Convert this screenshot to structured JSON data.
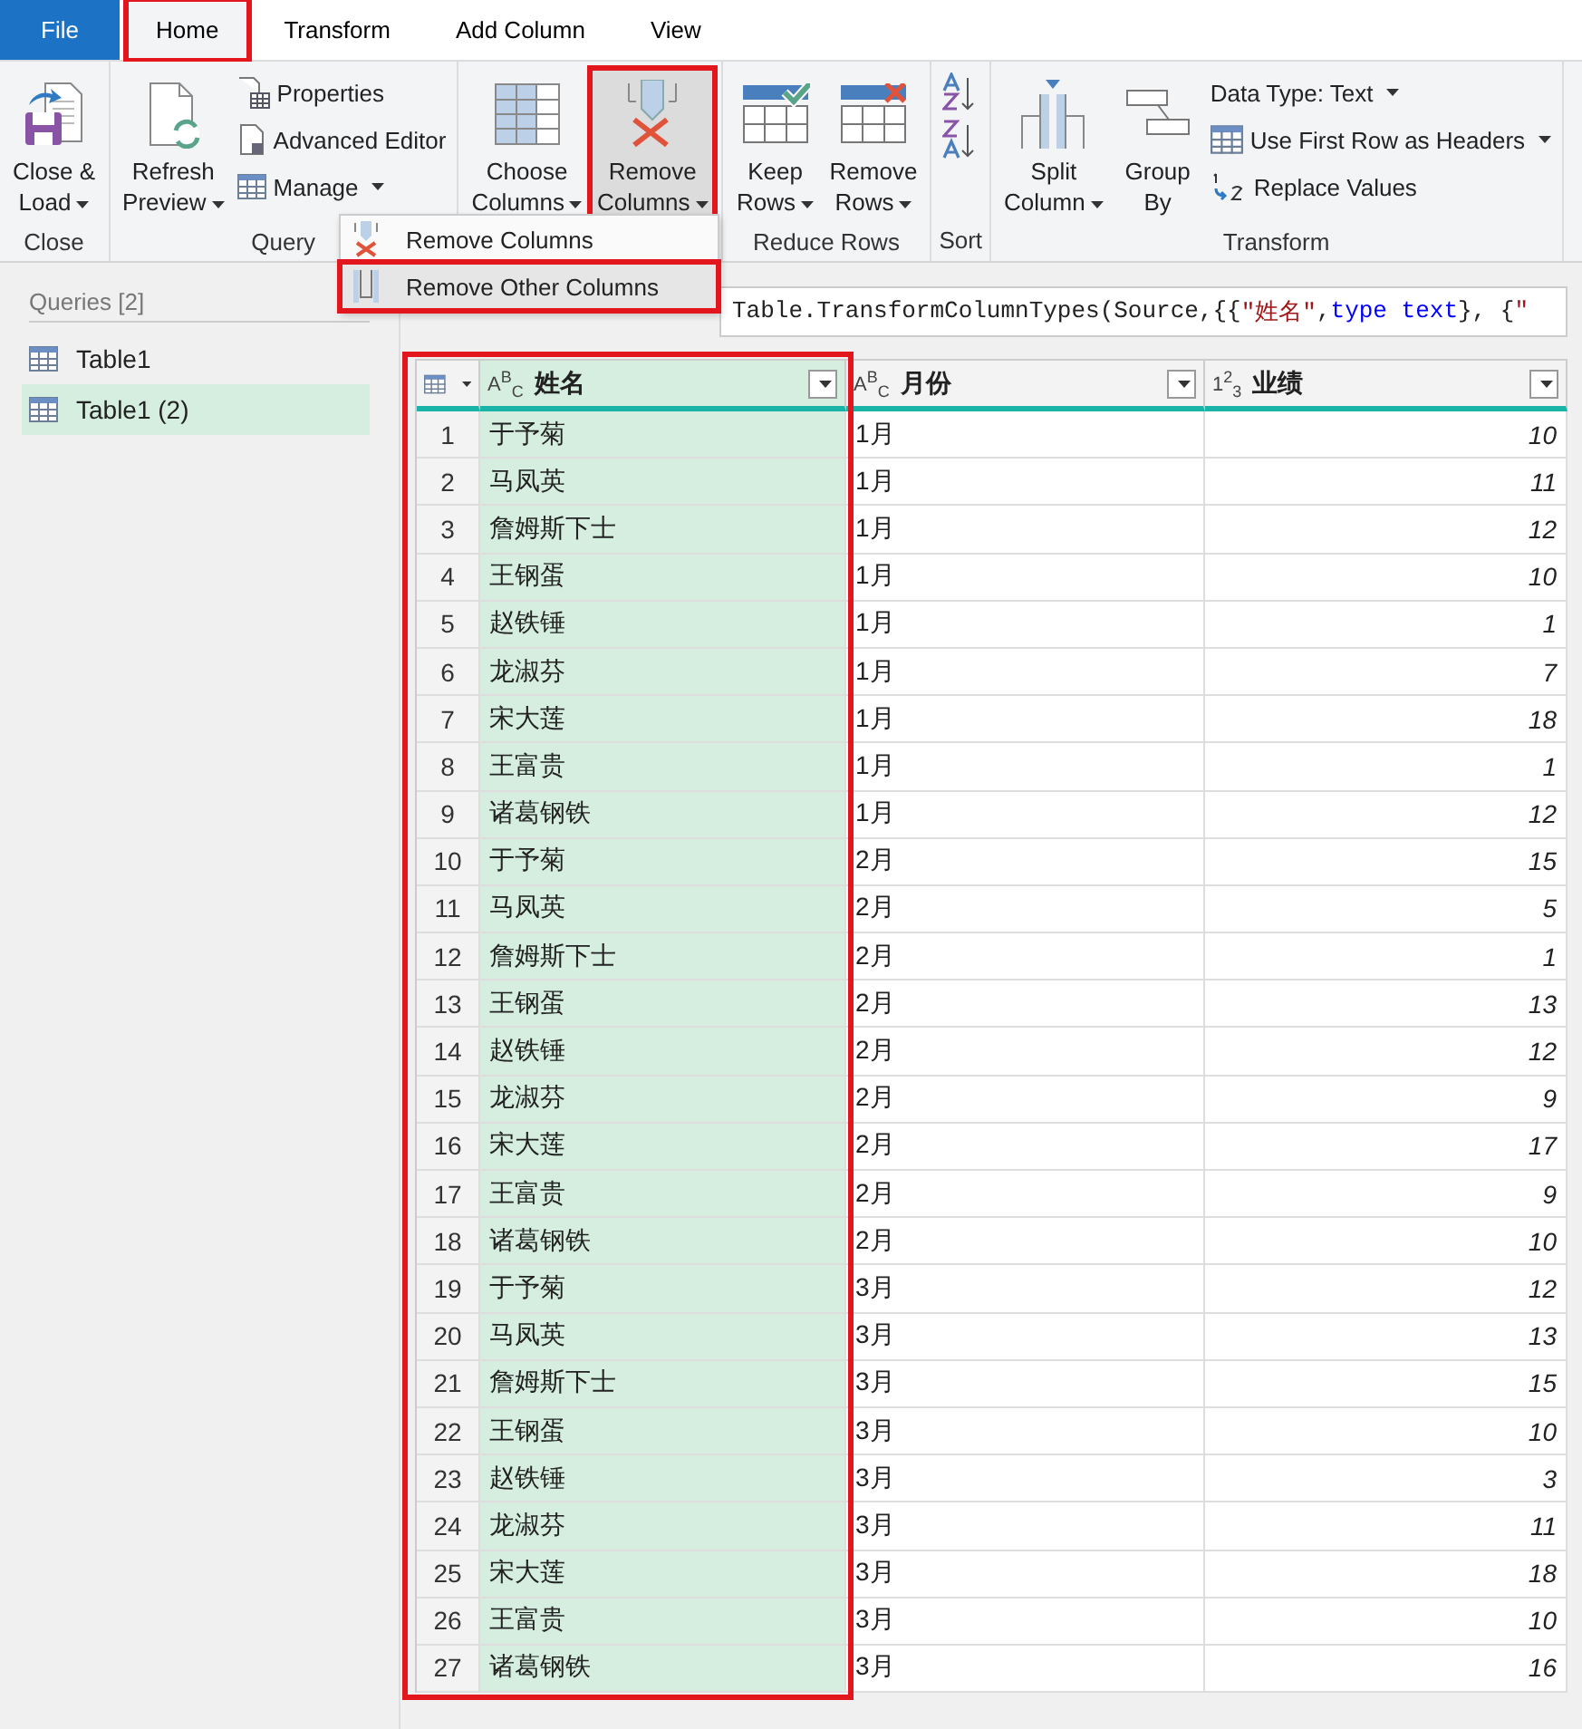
{
  "tabs": [
    {
      "label": "File",
      "kind": "file",
      "selected": false,
      "highlighted": false
    },
    {
      "label": "Home",
      "kind": "tab",
      "selected": true,
      "highlighted": true
    },
    {
      "label": "Transform",
      "kind": "tab",
      "selected": false,
      "highlighted": false
    },
    {
      "label": "Add Column",
      "kind": "tab",
      "selected": false,
      "highlighted": false
    },
    {
      "label": "View",
      "kind": "tab",
      "selected": false,
      "highlighted": false
    }
  ],
  "ribbon": {
    "groups": [
      {
        "label": "Close",
        "large": [
          {
            "lines": [
              "Close &",
              "Load"
            ],
            "dropdown": true,
            "pressed": false,
            "highlighted": false
          }
        ]
      },
      {
        "label": "Query",
        "large": [
          {
            "lines": [
              "Refresh",
              "Preview"
            ],
            "dropdown": true,
            "pressed": false,
            "highlighted": false
          }
        ],
        "small": [
          {
            "label": "Properties",
            "dropdown": false
          },
          {
            "label": "Advanced Editor",
            "dropdown": false
          },
          {
            "label": "Manage",
            "dropdown": true
          }
        ]
      },
      {
        "large": [
          {
            "lines": [
              "Choose",
              "Columns"
            ],
            "dropdown": true,
            "pressed": false,
            "highlighted": false
          },
          {
            "lines": [
              "Remove",
              "Columns"
            ],
            "dropdown": true,
            "pressed": true,
            "highlighted": true
          }
        ]
      },
      {
        "label": "Reduce Rows",
        "large": [
          {
            "lines": [
              "Keep",
              "Rows"
            ],
            "dropdown": true,
            "pressed": false,
            "highlighted": false
          },
          {
            "lines": [
              "Remove",
              "Rows"
            ],
            "dropdown": true,
            "pressed": false,
            "highlighted": false
          }
        ]
      },
      {
        "label": "Sort",
        "small": [
          {
            "dropdown": false
          },
          {
            "dropdown": false
          }
        ]
      },
      {
        "label": "Transform",
        "large": [
          {
            "lines": [
              "Split",
              "Column"
            ],
            "dropdown": true,
            "pressed": false,
            "highlighted": false
          },
          {
            "lines": [
              "Group",
              "By"
            ],
            "dropdown": false,
            "pressed": false,
            "highlighted": false
          }
        ],
        "small": [
          {
            "label": "Data Type: Text",
            "dropdown": true
          },
          {
            "label": "Use First Row as Headers",
            "dropdown": true
          },
          {
            "label": "Replace Values",
            "dropdown": false
          }
        ]
      }
    ]
  },
  "menu": {
    "items": [
      {
        "label": "Remove Columns",
        "selected": false,
        "highlighted": false
      },
      {
        "label": "Remove Other Columns",
        "selected": true,
        "highlighted": true
      }
    ]
  },
  "queries": {
    "title": "Queries [2]",
    "items": [
      {
        "label": "Table1",
        "selected": false
      },
      {
        "label": "Table1 (2)",
        "selected": true
      }
    ]
  },
  "formula": {
    "tokens": [
      {
        "kind": "plain",
        "text": "Table.TransformColumnTypes(Source,{{"
      },
      {
        "kind": "string",
        "text": "\"姓名\""
      },
      {
        "kind": "plain",
        "text": ", "
      },
      {
        "kind": "keyword",
        "text": "type text"
      },
      {
        "kind": "plain",
        "text": "}, {"
      },
      {
        "kind": "string",
        "text": "\""
      }
    ]
  },
  "table": {
    "columns": [
      {
        "type": "A$^{B}$$_{C}$",
        "name": "姓名",
        "selected": true,
        "highlighted": true
      },
      {
        "type": "A$^{B}$$_{C}$",
        "name": "月份",
        "selected": false,
        "highlighted": false
      },
      {
        "type": "1$^{2}$$_{3}$",
        "name": "业绩",
        "selected": false,
        "highlighted": false
      }
    ],
    "rows": [
      {
        "number": "1",
        "cells": [
          "于予菊",
          "1月",
          "10"
        ]
      },
      {
        "number": "2",
        "cells": [
          "马凤英",
          "1月",
          "11"
        ]
      },
      {
        "number": "3",
        "cells": [
          "詹姆斯下士",
          "1月",
          "12"
        ]
      },
      {
        "number": "4",
        "cells": [
          "王钢蛋",
          "1月",
          "10"
        ]
      },
      {
        "number": "5",
        "cells": [
          "赵铁锤",
          "1月",
          "1"
        ]
      },
      {
        "number": "6",
        "cells": [
          "龙淑芬",
          "1月",
          "7"
        ]
      },
      {
        "number": "7",
        "cells": [
          "宋大莲",
          "1月",
          "18"
        ]
      },
      {
        "number": "8",
        "cells": [
          "王富贵",
          "1月",
          "1"
        ]
      },
      {
        "number": "9",
        "cells": [
          "诸葛钢铁",
          "1月",
          "12"
        ]
      },
      {
        "number": "10",
        "cells": [
          "于予菊",
          "2月",
          "15"
        ]
      },
      {
        "number": "11",
        "cells": [
          "马凤英",
          "2月",
          "5"
        ]
      },
      {
        "number": "12",
        "cells": [
          "詹姆斯下士",
          "2月",
          "1"
        ]
      },
      {
        "number": "13",
        "cells": [
          "王钢蛋",
          "2月",
          "13"
        ]
      },
      {
        "number": "14",
        "cells": [
          "赵铁锤",
          "2月",
          "12"
        ]
      },
      {
        "number": "15",
        "cells": [
          "龙淑芬",
          "2月",
          "9"
        ]
      },
      {
        "number": "16",
        "cells": [
          "宋大莲",
          "2月",
          "17"
        ]
      },
      {
        "number": "17",
        "cells": [
          "王富贵",
          "2月",
          "9"
        ]
      },
      {
        "number": "18",
        "cells": [
          "诸葛钢铁",
          "2月",
          "10"
        ]
      },
      {
        "number": "19",
        "cells": [
          "于予菊",
          "3月",
          "12"
        ]
      },
      {
        "number": "20",
        "cells": [
          "马凤英",
          "3月",
          "13"
        ]
      },
      {
        "number": "21",
        "cells": [
          "詹姆斯下士",
          "3月",
          "15"
        ]
      },
      {
        "number": "22",
        "cells": [
          "王钢蛋",
          "3月",
          "10"
        ]
      },
      {
        "number": "23",
        "cells": [
          "赵铁锤",
          "3月",
          "3"
        ]
      },
      {
        "number": "24",
        "cells": [
          "龙淑芬",
          "3月",
          "11"
        ]
      },
      {
        "number": "25",
        "cells": [
          "宋大莲",
          "3月",
          "18"
        ]
      },
      {
        "number": "26",
        "cells": [
          "王富贵",
          "3月",
          "10"
        ]
      },
      {
        "number": "27",
        "cells": [
          "诸葛钢铁",
          "3月",
          "16"
        ]
      }
    ]
  }
}
